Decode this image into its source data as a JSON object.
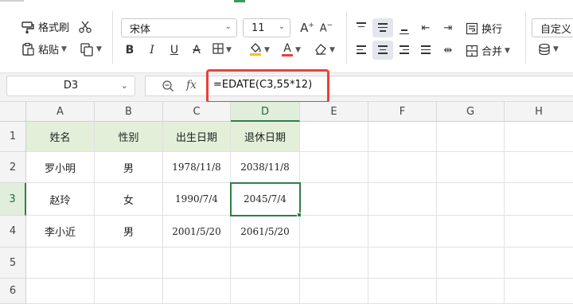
{
  "ribbon": {
    "format_painter": "格式刷",
    "paste": "粘贴",
    "font_name": "宋体",
    "font_size": "11",
    "wrap_text": "换行",
    "merge": "合并",
    "number_format": "自定义"
  },
  "formula_bar": {
    "cell_ref": "D3",
    "fx": "fx",
    "formula": "=EDATE(C3,55*12)"
  },
  "columns": [
    "A",
    "B",
    "C",
    "D",
    "E",
    "F",
    "G",
    "H"
  ],
  "rows": [
    "1",
    "2",
    "3",
    "4",
    "5",
    "6"
  ],
  "table": {
    "headers": [
      "姓名",
      "性别",
      "出生日期",
      "退休日期"
    ],
    "data": [
      [
        "罗小明",
        "男",
        "1978/11/8",
        "2038/11/8"
      ],
      [
        "赵玲",
        "女",
        "1990/7/4",
        "2045/7/4"
      ],
      [
        "李小近",
        "男",
        "2001/5/20",
        "2061/5/20"
      ]
    ]
  },
  "selected_cell": "D3",
  "colors": {
    "accent": "#2f7d4a",
    "highlight": "#e8413b",
    "header_fill": "#e3efd9"
  }
}
